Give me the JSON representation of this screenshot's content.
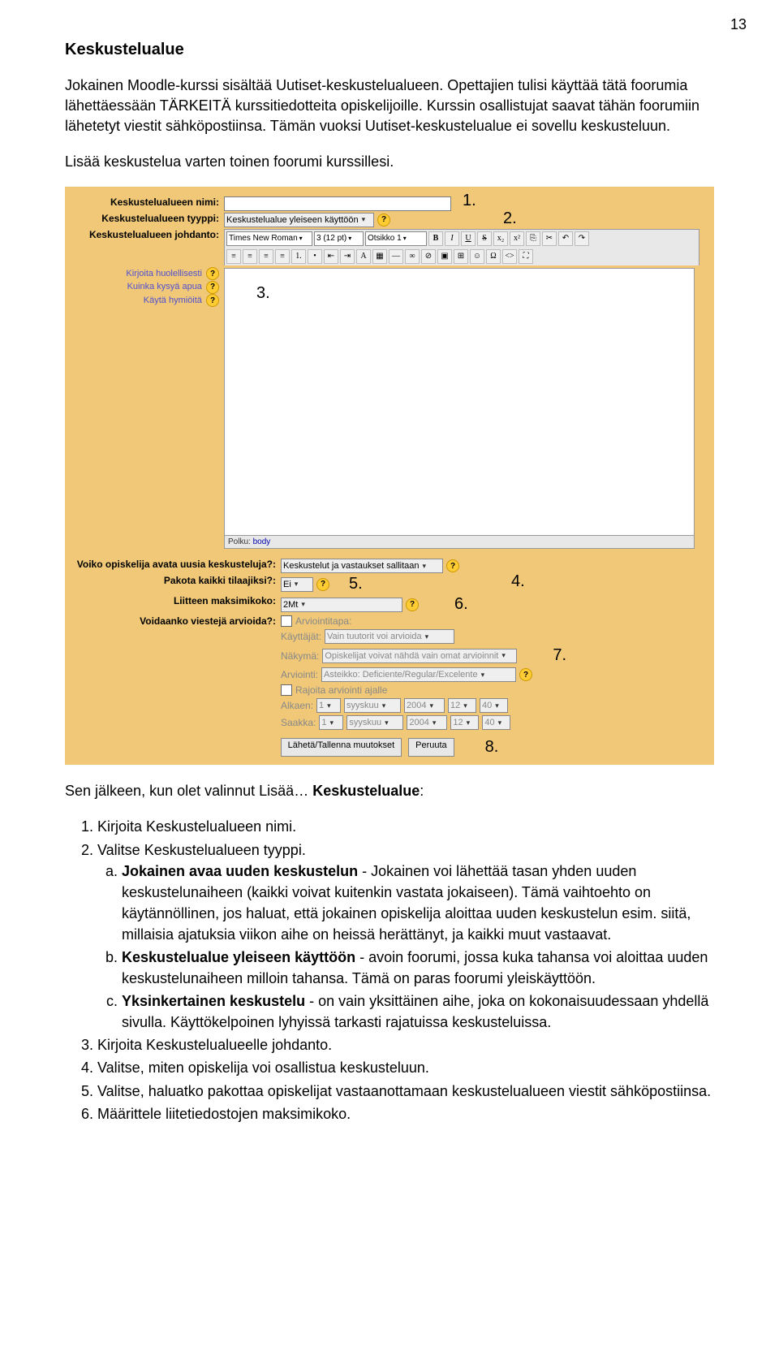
{
  "page_number": "13",
  "section_title": "Keskustelualue",
  "intro_p1": "Jokainen Moodle-kurssi sisältää Uutiset-keskustelualueen. Opettajien tulisi käyttää tätä foorumia lähettäessään TÄRKEITÄ kurssitiedotteita opiskelijoille. Kurssin osallistujat saavat tähän foorumiin lähetetyt viestit sähköpostiinsa. Tämän vuoksi Uutiset-keskustelualue ei sovellu keskusteluun.",
  "intro_p2": "Lisää keskustelua varten toinen foorumi kurssillesi.",
  "form": {
    "label_name": "Keskustelualueen nimi:",
    "label_type": "Keskustelualueen tyyppi:",
    "type_value": "Keskustelualue yleiseen käyttöön",
    "label_intro": "Keskustelualueen johdanto:",
    "font_family": "Times New Roman",
    "font_size": "3 (12 pt)",
    "heading_style": "Otsikko 1",
    "tip1": "Kirjoita huolellisesti",
    "tip2": "Kuinka kysyä apua",
    "tip3": "Käytä hymiöitä",
    "path_label": "Polku:",
    "path_value": "body",
    "label_open": "Voiko opiskelija avata uusia keskusteluja?:",
    "open_value": "Keskustelut ja vastaukset sallitaan",
    "label_force": "Pakota kaikki tilaajiksi?:",
    "force_value": "Ei",
    "label_maxsize": "Liitteen maksimikoko:",
    "maxsize_value": "2Mt",
    "label_rate": "Voidaanko viestejä arvioida?:",
    "rate_chk_label": "Arviointitapa:",
    "rate_users_label": "Käyttäjät:",
    "rate_users_value": "Vain tuutorit voi arvioida",
    "rate_view_label": "Näkymä:",
    "rate_view_value": "Opiskelijat voivat nähdä vain omat arvioinnit",
    "rate_scale_label": "Arviointi:",
    "rate_scale_value": "Asteikko: Deficiente/Regular/Excelente",
    "rate_restrict_label": "Rajoita arviointi ajalle",
    "rate_from_label": "Alkaen:",
    "rate_to_label": "Saakka:",
    "day1": "1",
    "month": "syyskuu",
    "year": "2004",
    "hour": "12",
    "min": "40",
    "btn_save": "Lähetä/Tallenna muutokset",
    "btn_cancel": "Peruuta"
  },
  "annot": {
    "a1": "1.",
    "a2": "2.",
    "a3": "3.",
    "a4": "4.",
    "a5": "5.",
    "a6": "6.",
    "a7": "7.",
    "a8": "8."
  },
  "after_heading_prefix": "Sen jälkeen, kun olet valinnut Lisää… ",
  "after_heading_bold": "Keskustelualue",
  "after_heading_suffix": ":",
  "list": {
    "i1": "Kirjoita Keskustelualueen nimi.",
    "i2": "Valitse Keskustelualueen tyyppi.",
    "i2a_bold": "Jokainen avaa uuden keskustelun",
    "i2a_rest": " - Jokainen voi lähettää tasan yhden uuden keskustelunaiheen (kaikki voivat kuitenkin vastata jokaiseen). Tämä vaihtoehto on käytännöllinen, jos haluat, että jokainen opiskelija aloittaa uuden keskustelun esim. siitä, millaisia ajatuksia viikon aihe on heissä herättänyt, ja kaikki muut vastaavat.",
    "i2b_bold": "Keskustelualue yleiseen käyttöön",
    "i2b_rest": " - avoin foorumi, jossa kuka tahansa voi aloittaa uuden keskustelunaiheen milloin tahansa. Tämä on paras foorumi yleiskäyttöön.",
    "i2c_bold": "Yksinkertainen keskustelu",
    "i2c_rest": " - on vain yksittäinen aihe, joka on kokonaisuudessaan yhdellä sivulla. Käyttökelpoinen lyhyissä tarkasti rajatuissa keskusteluissa.",
    "i3": "Kirjoita Keskustelualueelle johdanto.",
    "i4": "Valitse, miten opiskelija voi osallistua keskusteluun.",
    "i5": "Valitse, haluatko pakottaa opiskelijat vastaanottamaan keskustelualueen viestit sähköpostiinsa.",
    "i6": "Määrittele liitetiedostojen maksimikoko."
  }
}
